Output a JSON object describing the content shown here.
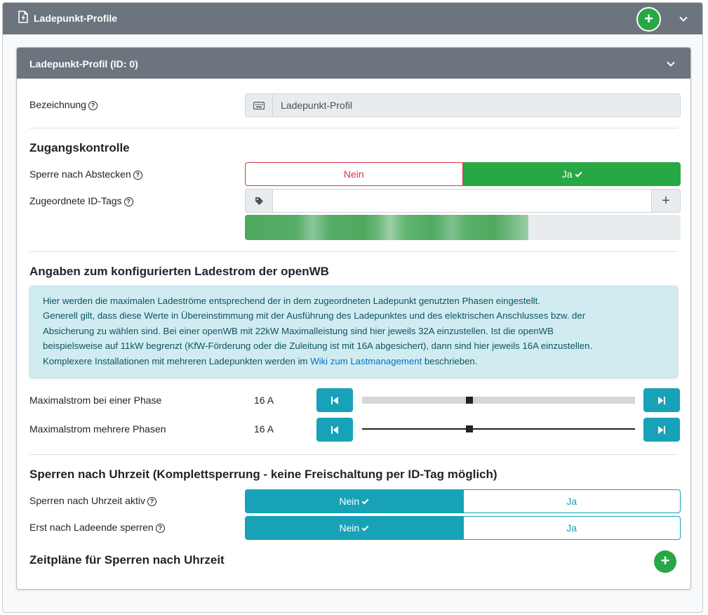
{
  "outer": {
    "title": "Ladepunkt-Profile",
    "add_label": "+"
  },
  "profile": {
    "title": "Ladepunkt-Profil (ID: 0)",
    "name_label": "Bezeichnung",
    "name_value": "Ladepunkt-Profil",
    "help_glyph": "?"
  },
  "access": {
    "section_title": "Zugangskontrolle",
    "lock_label": "Sperre nach Abstecken",
    "lock_options": [
      "Nein",
      "Ja"
    ],
    "lock_selected": "Ja",
    "idtags_label": "Zugeordnete ID-Tags",
    "idtags_value": "",
    "idtags_add": "+",
    "idtags_progress": 0.65
  },
  "current": {
    "section_title": "Angaben zum konfigurierten Ladestrom der openWB",
    "info_text_1": "Hier werden die maximalen Ladeströme entsprechend der in dem zugeordneten Ladepunkt genutzten Phasen eingestellt.",
    "info_text_2": "Generell gilt, dass diese Werte in Übereinstimmung mit der Ausführung des Ladepunktes und des elektrischen Anschlusses bzw. der",
    "info_text_3": "Absicherung zu wählen sind. Bei einer openWB mit 22kW Maximalleistung sind hier jeweils 32A einzustellen. Ist die openWB",
    "info_text_4": "beispielsweise auf 11kW begrenzt (KfW-Förderung oder die Zuleitung ist mit 16A abgesichert), dann sind hier jeweils 16A einzustellen.",
    "info_text_5a": "Komplexere Installationen mit mehreren Ladepunkten werden im",
    "info_link": "Wiki zum Lastmanagement",
    "info_text_5b": "beschrieben.",
    "single_label": "Maximalstrom bei einer Phase",
    "single_value": "16 A",
    "single_level": 0.39,
    "multi_label": "Maximalstrom mehrere Phasen",
    "multi_value": "16 A",
    "multi_level": 0.39
  },
  "timelock": {
    "section_title": "Sperren nach Uhrzeit (Komplettsperrung - keine Freischaltung per ID-Tag möglich)",
    "active_label": "Sperren nach Uhrzeit aktiv",
    "active_options": [
      "Nein",
      "Ja"
    ],
    "active_selected": "Nein",
    "end_label": "Erst nach Ladeende sperren",
    "end_options": [
      "Nein",
      "Ja"
    ],
    "end_selected": "Nein",
    "schedules_title": "Zeitpläne für Sperren nach Uhrzeit",
    "add_label": "+"
  },
  "colors": {
    "header": "#6c757d",
    "success": "#28a745",
    "danger": "#dc3545",
    "info": "#17a2b8",
    "alert_bg": "#d1ecf1"
  }
}
